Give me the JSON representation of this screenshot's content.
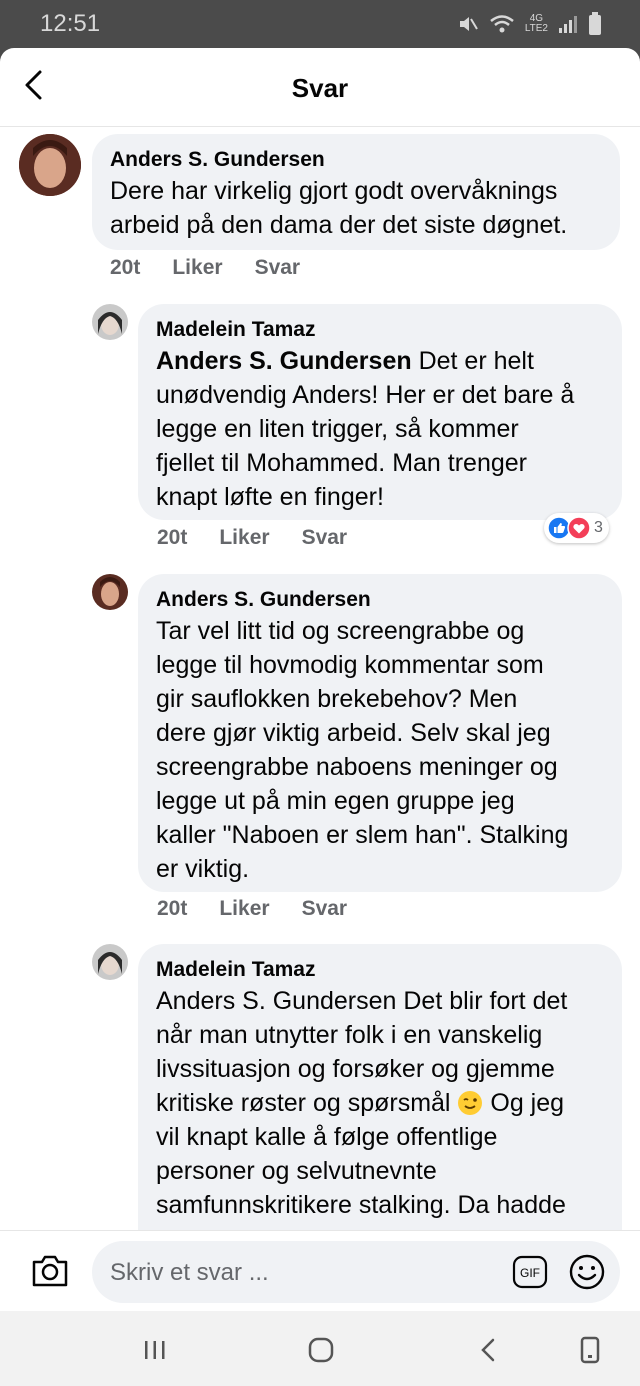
{
  "status_bar": {
    "time": "12:51",
    "network": "4G",
    "network_sub": "LTE2"
  },
  "header": {
    "title": "Svar"
  },
  "comments": [
    {
      "author": "Anders S. Gundersen",
      "mention": "",
      "text": "Dere har virkelig gjort godt overvåknings arbeid på den dama der det siste døgnet.",
      "lines": [
        "Dere har virkelig gjort godt overvåknings",
        "arbeid på den dama der det siste døgnet."
      ],
      "time": "20t",
      "like": "Liker",
      "reply": "Svar"
    },
    {
      "author": "Madelein Tamaz",
      "mention": "Anders S. Gundersen",
      "lines": [
        "Det er helt",
        "unødvendig Anders! Her er det bare å",
        "legge en liten trigger, så kommer",
        "fjellet til Mohammed. Man trenger",
        "knapt løfte en finger!"
      ],
      "time": "20t",
      "like": "Liker",
      "reply": "Svar",
      "reactions": {
        "count": "3",
        "types": [
          "like",
          "love"
        ]
      }
    },
    {
      "author": "Anders S. Gundersen",
      "mention": "",
      "lines": [
        "Tar vel litt tid og screengrabbe og",
        "legge til hovmodig kommentar som",
        "gir sauflokken brekebehov? Men",
        "dere gjør viktig arbeid. Selv skal jeg",
        "screengrabbe naboens meninger og",
        "legge ut på min egen gruppe jeg",
        "kaller \"Naboen er slem han\". Stalking",
        "er viktig."
      ],
      "time": "20t",
      "like": "Liker",
      "reply": "Svar"
    },
    {
      "author": "Madelein Tamaz",
      "mention": "",
      "lines": [
        "Anders S. Gundersen Det blir fort det",
        "når man utnytter folk i en vanskelig",
        "livssituasjon og forsøker og gjemme",
        "kritiske røster og spørsmål",
        "Og jeg",
        "vil knapt kalle å følge offentlige",
        "personer og selvutnevnte",
        "samfunnskritikere stalking. Da hadde"
      ]
    }
  ],
  "composer": {
    "placeholder": "Skriv et svar ...",
    "gif_label": "GIF"
  },
  "icons": {
    "back": "chevron-left-icon",
    "camera": "camera-icon",
    "gif": "gif-icon",
    "emoji": "emoji-icon",
    "recents": "recents-icon",
    "home": "home-icon",
    "nav_back": "back-icon",
    "rotate": "rotate-icon"
  },
  "colors": {
    "like_blue": "#1877f2",
    "love_red": "#f33e58",
    "bubble_bg": "#f0f2f5",
    "meta_gray": "#65676b"
  }
}
